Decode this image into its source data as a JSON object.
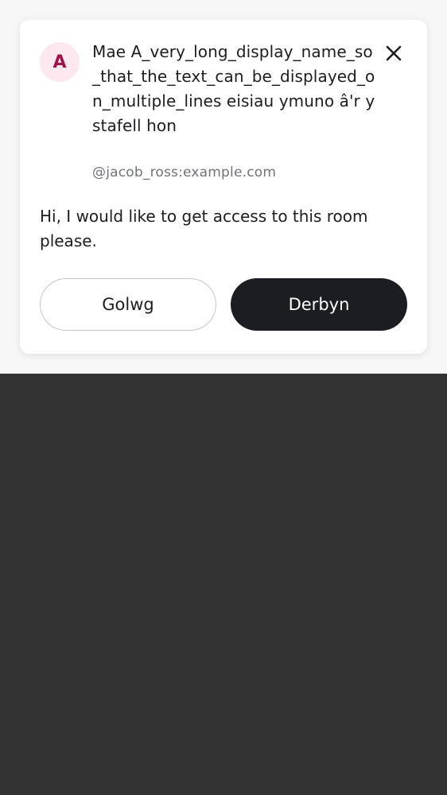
{
  "request": {
    "avatar_initial": "A",
    "title": "Mae A_very_long_display_name_so_that_the_text_can_be_displayed_on_multiple_lines eisiau ymuno â'r ystafell hon",
    "handle": "@jacob_ross:example.com",
    "message": "Hi, I would like to get access to this room please."
  },
  "actions": {
    "view_label": "Golwg",
    "accept_label": "Derbyn"
  },
  "colors": {
    "avatar_bg": "#fde8f0",
    "avatar_fg": "#a0124a",
    "primary_button": "#1b1d22",
    "backdrop": "#333333"
  },
  "icons": {
    "close": "close-icon"
  }
}
